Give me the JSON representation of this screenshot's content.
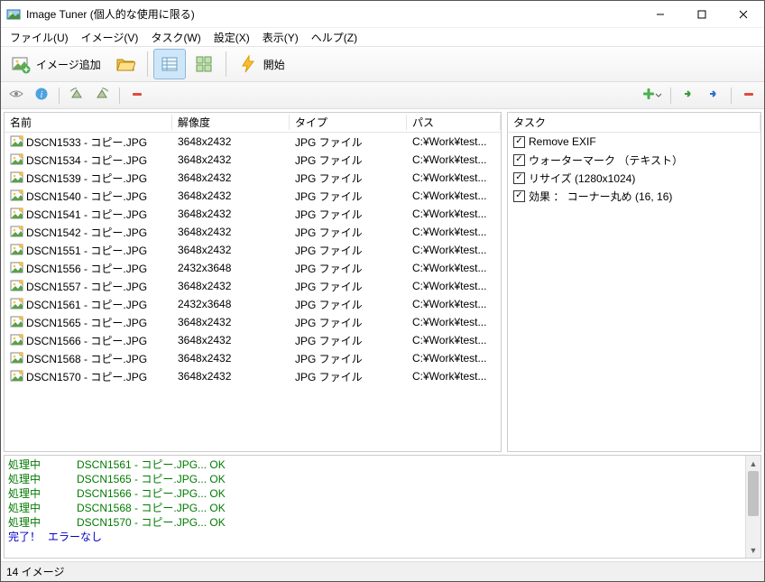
{
  "window": {
    "title": "Image Tuner (個人的な使用に限る)"
  },
  "menu": {
    "file": "ファイル(U)",
    "image": "イメージ(V)",
    "task": "タスク(W)",
    "settings": "設定(X)",
    "view": "表示(Y)",
    "help": "ヘルプ(Z)"
  },
  "toolbar": {
    "add_image": "イメージ追加",
    "start": "開始"
  },
  "columns": {
    "name": "名前",
    "resolution": "解像度",
    "type": "タイプ",
    "path": "パス",
    "task": "タスク"
  },
  "files": [
    {
      "name": "DSCN1533 - コピー.JPG",
      "res": "3648x2432",
      "type": "JPG ファイル",
      "path": "C:¥Work¥test..."
    },
    {
      "name": "DSCN1534 - コピー.JPG",
      "res": "3648x2432",
      "type": "JPG ファイル",
      "path": "C:¥Work¥test..."
    },
    {
      "name": "DSCN1539 - コピー.JPG",
      "res": "3648x2432",
      "type": "JPG ファイル",
      "path": "C:¥Work¥test..."
    },
    {
      "name": "DSCN1540 - コピー.JPG",
      "res": "3648x2432",
      "type": "JPG ファイル",
      "path": "C:¥Work¥test..."
    },
    {
      "name": "DSCN1541 - コピー.JPG",
      "res": "3648x2432",
      "type": "JPG ファイル",
      "path": "C:¥Work¥test..."
    },
    {
      "name": "DSCN1542 - コピー.JPG",
      "res": "3648x2432",
      "type": "JPG ファイル",
      "path": "C:¥Work¥test..."
    },
    {
      "name": "DSCN1551 - コピー.JPG",
      "res": "3648x2432",
      "type": "JPG ファイル",
      "path": "C:¥Work¥test..."
    },
    {
      "name": "DSCN1556 - コピー.JPG",
      "res": "2432x3648",
      "type": "JPG ファイル",
      "path": "C:¥Work¥test..."
    },
    {
      "name": "DSCN1557 - コピー.JPG",
      "res": "3648x2432",
      "type": "JPG ファイル",
      "path": "C:¥Work¥test..."
    },
    {
      "name": "DSCN1561 - コピー.JPG",
      "res": "2432x3648",
      "type": "JPG ファイル",
      "path": "C:¥Work¥test..."
    },
    {
      "name": "DSCN1565 - コピー.JPG",
      "res": "3648x2432",
      "type": "JPG ファイル",
      "path": "C:¥Work¥test..."
    },
    {
      "name": "DSCN1566 - コピー.JPG",
      "res": "3648x2432",
      "type": "JPG ファイル",
      "path": "C:¥Work¥test..."
    },
    {
      "name": "DSCN1568 - コピー.JPG",
      "res": "3648x2432",
      "type": "JPG ファイル",
      "path": "C:¥Work¥test..."
    },
    {
      "name": "DSCN1570 - コピー.JPG",
      "res": "3648x2432",
      "type": "JPG ファイル",
      "path": "C:¥Work¥test..."
    }
  ],
  "tasks": [
    {
      "checked": true,
      "label": "Remove EXIF"
    },
    {
      "checked": true,
      "label": "ウォーターマーク （テキスト）"
    },
    {
      "checked": true,
      "label": "リサイズ (1280x1024)"
    },
    {
      "checked": true,
      "label": "効果 ： コーナー丸め (16, 16)"
    }
  ],
  "log": {
    "lines": [
      {
        "proc": "処理中",
        "msg": "DSCN1561 - コピー.JPG... OK"
      },
      {
        "proc": "処理中",
        "msg": "DSCN1565 - コピー.JPG... OK"
      },
      {
        "proc": "処理中",
        "msg": "DSCN1566 - コピー.JPG... OK"
      },
      {
        "proc": "処理中",
        "msg": "DSCN1568 - コピー.JPG... OK"
      },
      {
        "proc": "処理中",
        "msg": "DSCN1570 - コピー.JPG... OK"
      }
    ],
    "done": "完了！",
    "error": "エラーなし"
  },
  "status": {
    "count": "14 イメージ"
  }
}
